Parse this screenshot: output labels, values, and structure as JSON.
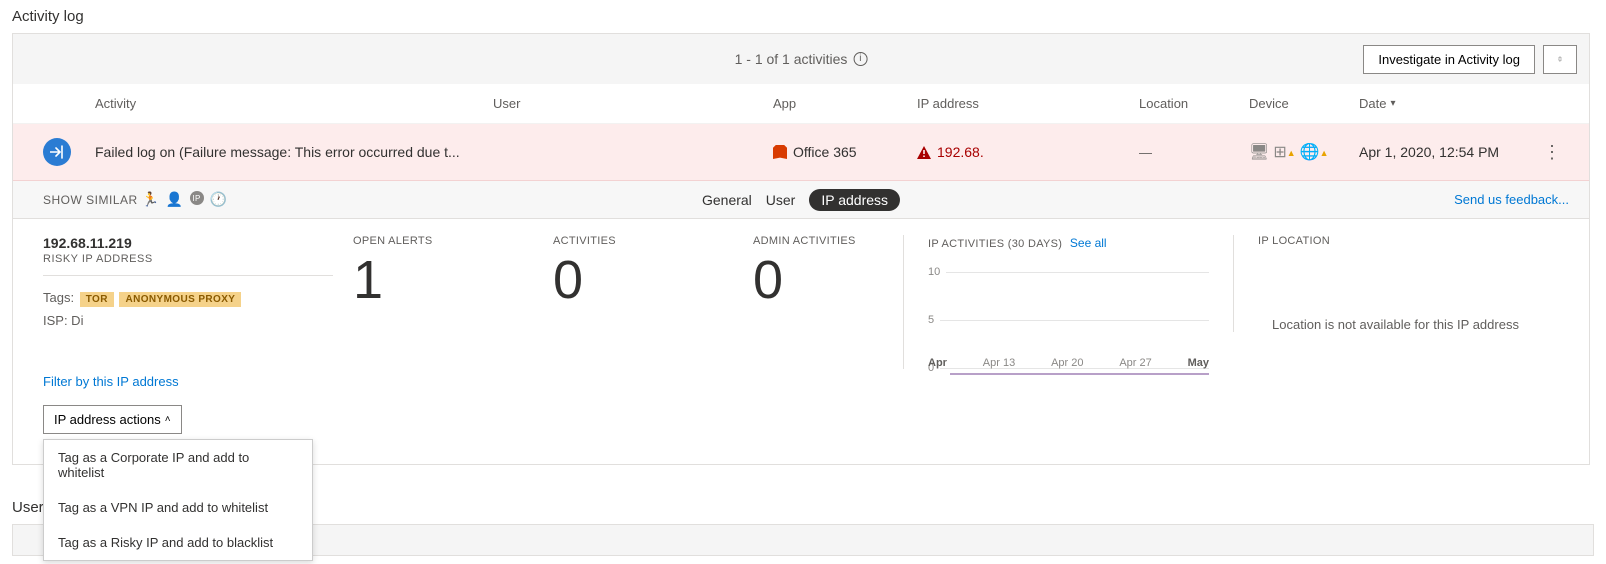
{
  "page_title": "Activity log",
  "header": {
    "result_count": "1 - 1 of 1 activities",
    "investigate_btn": "Investigate in Activity log"
  },
  "columns": {
    "activity": "Activity",
    "user": "User",
    "app": "App",
    "ip": "IP address",
    "location": "Location",
    "device": "Device",
    "date": "Date"
  },
  "row": {
    "activity": "Failed log on (Failure message: This error occurred due t...",
    "app": "Office 365",
    "ip": "192.68.",
    "location": "—",
    "date": "Apr 1, 2020, 12:54 PM"
  },
  "secondary": {
    "show_similar": "SHOW SIMILAR",
    "tab_general": "General",
    "tab_user": "User",
    "tab_ip": "IP address",
    "feedback": "Send us feedback..."
  },
  "ip": {
    "address": "192.68.11.219",
    "label": "RISKY IP ADDRESS",
    "tags_label": "Tags:",
    "tag1": "TOR",
    "tag2": "ANONYMOUS PROXY",
    "isp": "ISP: Di",
    "filter_link": "Filter by this IP address",
    "actions_btn": "IP address actions"
  },
  "stats": {
    "open_alerts_label": "OPEN ALERTS",
    "open_alerts_value": "1",
    "activities_label": "ACTIVITIES",
    "activities_value": "0",
    "admin_label": "ADMIN ACTIVITIES",
    "admin_value": "0"
  },
  "chart": {
    "title": "IP ACTIVITIES (30 DAYS)",
    "see_all": "See all"
  },
  "chart_data": {
    "type": "line",
    "x": [
      "Apr",
      "Apr 13",
      "Apr 20",
      "Apr 27",
      "May"
    ],
    "y_ticks": [
      "10",
      "5",
      "0"
    ],
    "values": [
      0,
      0,
      0,
      0,
      0
    ],
    "ylim": [
      0,
      10
    ]
  },
  "location_panel": {
    "title": "IP LOCATION",
    "message": "Location is not available for this IP address"
  },
  "menu": {
    "item1": "Tag as a Corporate IP and add to whitelist",
    "item2": "Tag as a VPN IP and add to whitelist",
    "item3": "Tag as a Risky IP and add to blacklist"
  },
  "below": {
    "title": "User"
  }
}
